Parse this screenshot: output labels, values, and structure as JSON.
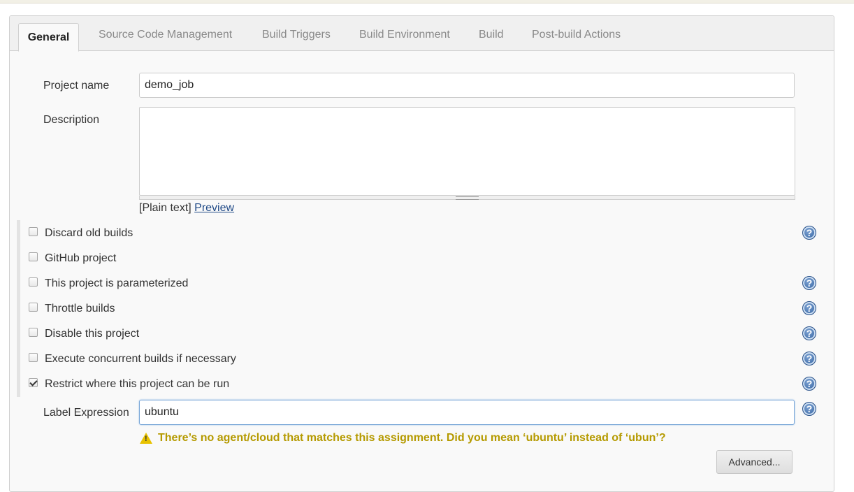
{
  "tabs": [
    {
      "label": "General",
      "active": true
    },
    {
      "label": "Source Code Management"
    },
    {
      "label": "Build Triggers"
    },
    {
      "label": "Build Environment"
    },
    {
      "label": "Build"
    },
    {
      "label": "Post-build Actions"
    }
  ],
  "form": {
    "project_name_label": "Project name",
    "project_name_value": "demo_job",
    "description_label": "Description",
    "description_value": "",
    "format_plain": "[Plain text]",
    "format_preview": "Preview"
  },
  "options": [
    {
      "label": "Discard old builds",
      "checked": false,
      "help": true
    },
    {
      "label": "GitHub project",
      "checked": false,
      "help": false
    },
    {
      "label": "This project is parameterized",
      "checked": false,
      "help": true
    },
    {
      "label": "Throttle builds",
      "checked": false,
      "help": true
    },
    {
      "label": "Disable this project",
      "checked": false,
      "help": true
    },
    {
      "label": "Execute concurrent builds if necessary",
      "checked": false,
      "help": true
    },
    {
      "label": "Restrict where this project can be run",
      "checked": true,
      "help": true
    }
  ],
  "label_expression": {
    "label": "Label Expression",
    "value": "ubuntu",
    "warning": "There’s no agent/cloud that matches this assignment. Did you mean ‘ubuntu’ instead of ‘ubun’?"
  },
  "advanced_button": "Advanced...",
  "help_symbol": "?",
  "colors": {
    "warning": "#b59a00",
    "link": "#204a87",
    "help": "#2f5f9e"
  }
}
